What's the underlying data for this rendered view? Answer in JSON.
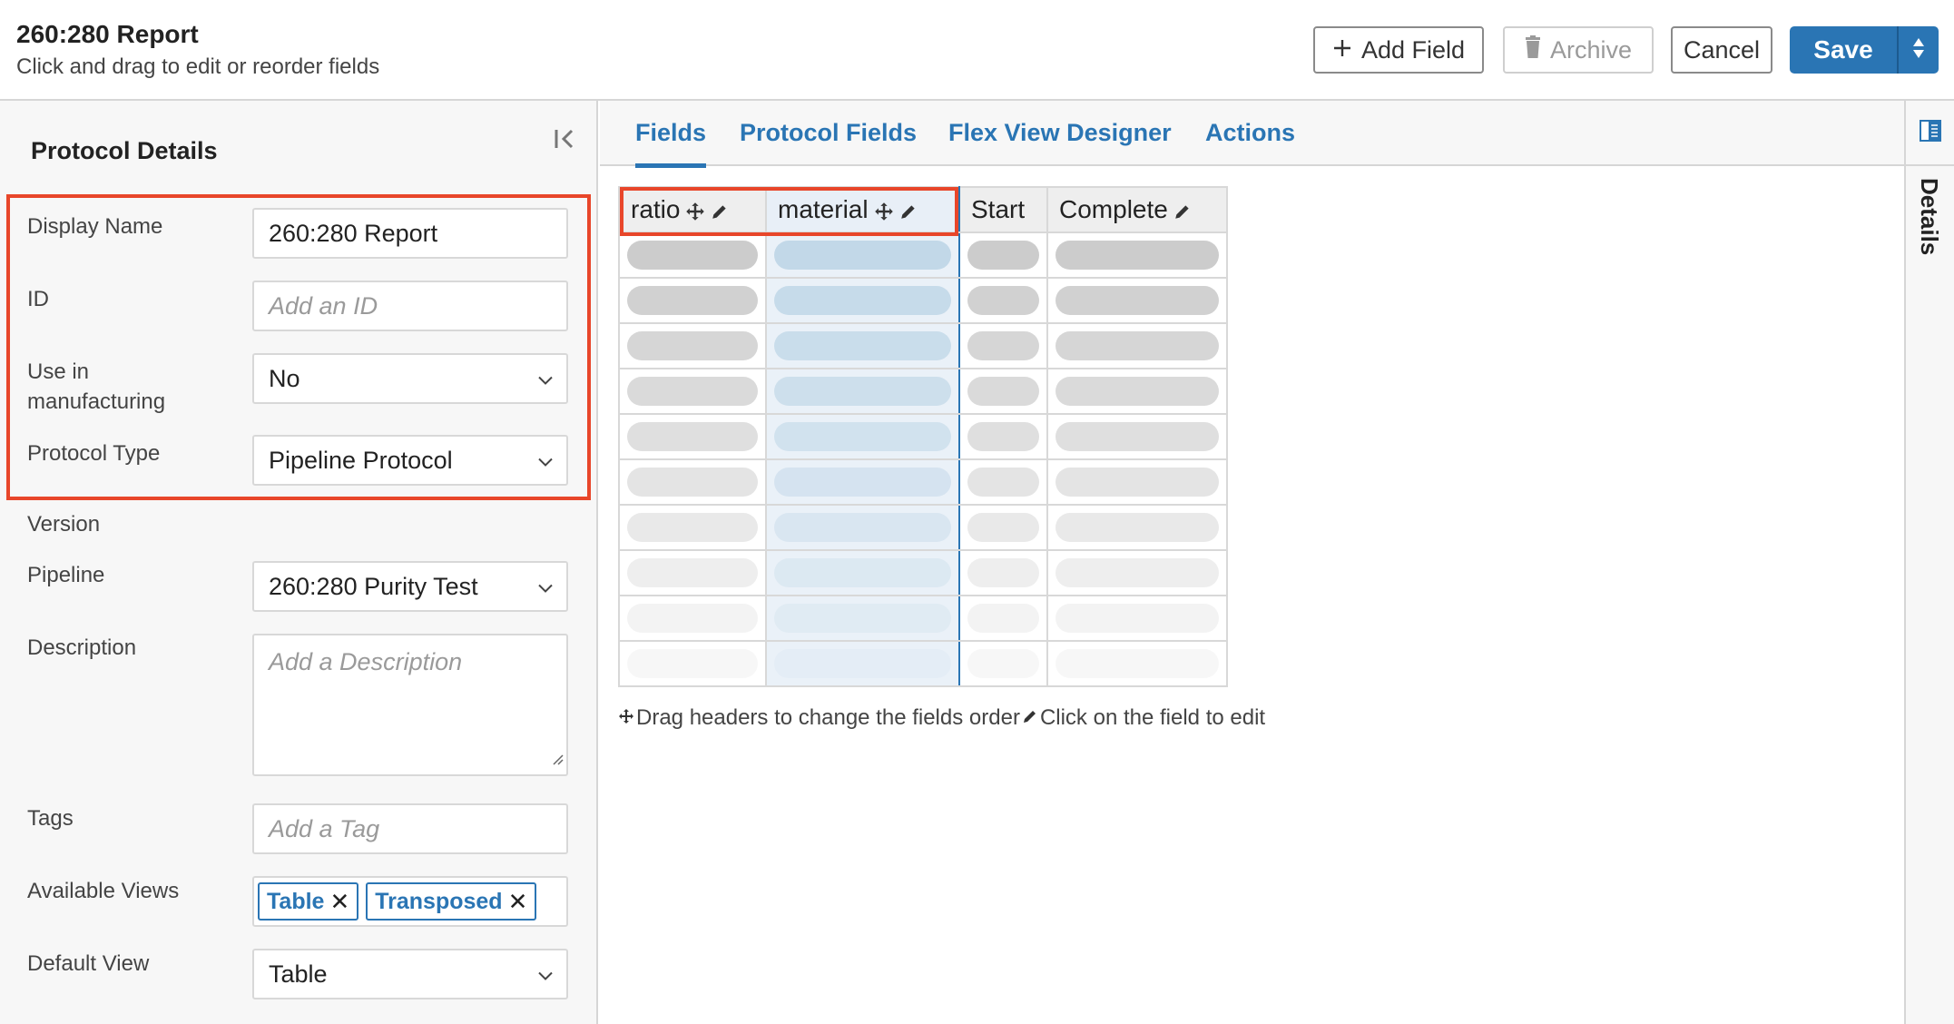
{
  "header": {
    "title": "260:280 Report",
    "subtitle": "Click and drag to edit or reorder fields",
    "buttons": {
      "add_field": "Add Field",
      "archive": "Archive",
      "cancel": "Cancel",
      "save": "Save"
    }
  },
  "left_panel": {
    "title": "Protocol Details",
    "fields": {
      "display_name": {
        "label": "Display Name",
        "value": "260:280 Report"
      },
      "id": {
        "label": "ID",
        "placeholder": "Add an ID"
      },
      "use_in_manufacturing": {
        "label": "Use in manufacturing",
        "value": "No"
      },
      "protocol_type": {
        "label": "Protocol Type",
        "value": "Pipeline Protocol"
      },
      "version": {
        "label": "Version"
      },
      "pipeline": {
        "label": "Pipeline",
        "value": "260:280 Purity Test"
      },
      "description": {
        "label": "Description",
        "placeholder": "Add a Description"
      },
      "tags": {
        "label": "Tags",
        "placeholder": "Add a Tag"
      },
      "available_views": {
        "label": "Available Views",
        "chips": [
          "Table",
          "Transposed"
        ]
      },
      "default_view": {
        "label": "Default View",
        "value": "Table"
      }
    }
  },
  "main": {
    "tabs": [
      {
        "label": "Fields",
        "active": true
      },
      {
        "label": "Protocol Fields",
        "active": false
      },
      {
        "label": "Flex View Designer",
        "active": false
      },
      {
        "label": "Actions",
        "active": false
      }
    ],
    "grid": {
      "columns": [
        {
          "name": "ratio",
          "movable": true,
          "editable": true,
          "selected": false
        },
        {
          "name": "material",
          "movable": true,
          "editable": true,
          "selected": true
        },
        {
          "name": "Start",
          "movable": false,
          "editable": false,
          "selected": false
        },
        {
          "name": "Complete",
          "movable": false,
          "editable": true,
          "selected": false
        }
      ],
      "placeholder_rows": 10
    },
    "help": {
      "drag": "Drag headers to change the fields order",
      "edit": "Click on the field to edit"
    }
  },
  "right_strip": {
    "label": "Details"
  },
  "colors": {
    "accent": "#2a75b4",
    "highlight": "#e8462a",
    "panel_bg": "#f7f7f7"
  }
}
